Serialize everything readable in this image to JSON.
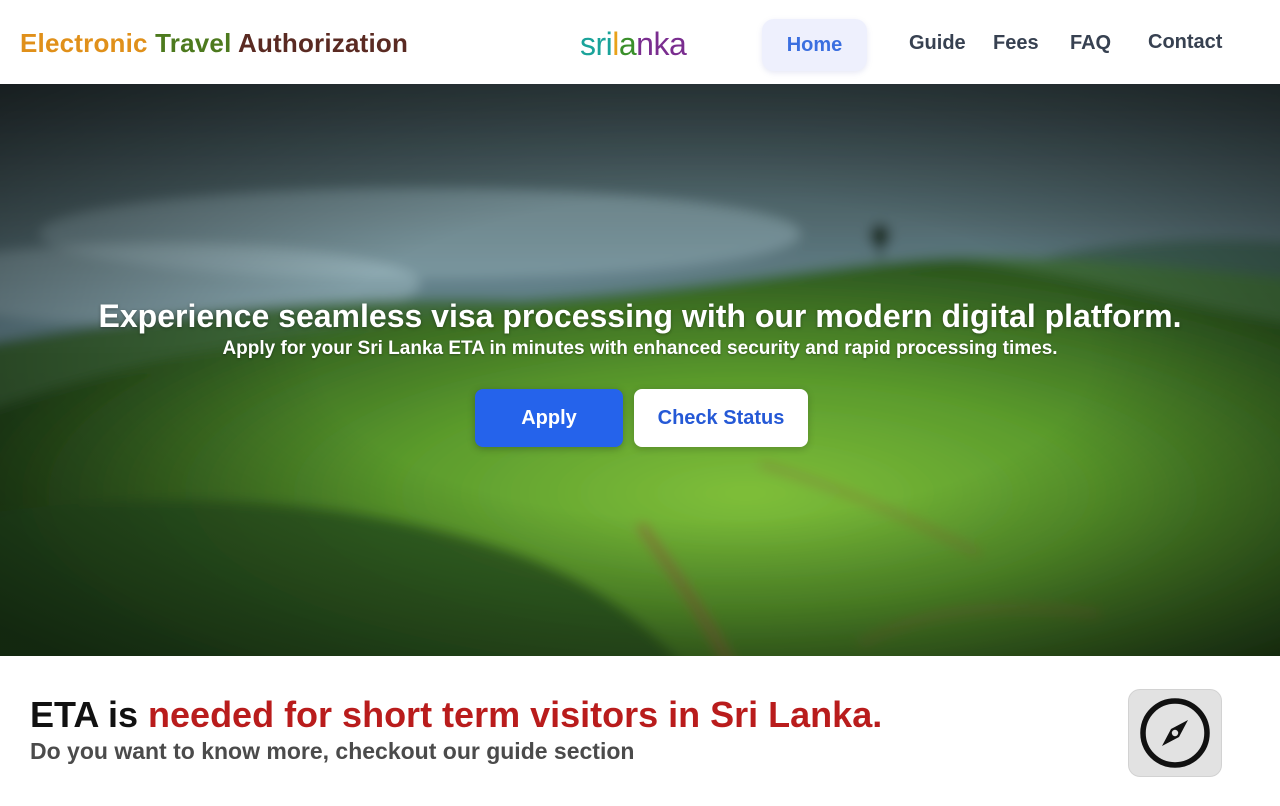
{
  "header": {
    "title_parts": [
      {
        "text": "Electronic ",
        "color": "#e0901a"
      },
      {
        "text": "Travel ",
        "color": "#4d7a1e"
      },
      {
        "text": "Authorization",
        "color": "#5a2a22"
      }
    ],
    "logo_parts": [
      {
        "text": "sri",
        "color": "#1aa39a"
      },
      {
        "text": "l",
        "color": "#e9a21a"
      },
      {
        "text": "a",
        "color": "#3a8f2a"
      },
      {
        "text": "nka",
        "color": "#7a2d8f"
      }
    ],
    "nav": {
      "home": "Home",
      "guide": "Guide",
      "fees": "Fees",
      "faq": "FAQ",
      "contact": "Contact"
    }
  },
  "hero": {
    "heading": "Experience seamless visa processing with our modern digital platform.",
    "subheading": "Apply for your Sri Lanka ETA in minutes with enhanced security and rapid processing times.",
    "apply_label": "Apply",
    "check_status_label": "Check Status"
  },
  "info": {
    "heading_dark": "ETA is ",
    "heading_red": "needed for short term visitors in Sri Lanka.",
    "subheading": "Do you want to know more, checkout our guide section",
    "guide_icon": "compass-icon"
  },
  "colors": {
    "accent_blue": "#2563eb",
    "accent_red": "#b91c1c",
    "nav_active_bg": "#eef0fd"
  }
}
